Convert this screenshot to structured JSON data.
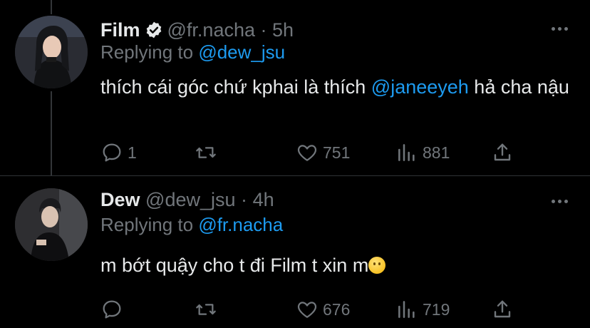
{
  "tweets": [
    {
      "name": "Film",
      "handle": "@fr.nacha",
      "separator": "·",
      "time": "5h",
      "replying_prefix": "Replying to",
      "replying_to": "@dew_jsu",
      "text_before": "thích cái góc chứ kphai là thích ",
      "text_mention": "@janeeyeh",
      "text_after": " hả cha nậu",
      "reply_count": "1",
      "retweet_count": "",
      "like_count": "751",
      "view_count": "881"
    },
    {
      "name": "Dew",
      "handle": "@dew_jsu",
      "separator": "·",
      "time": "4h",
      "replying_prefix": "Replying to",
      "replying_to": "@fr.nacha",
      "text_before": "m bớt quậy cho t đi Film t xin m",
      "reply_count": "",
      "retweet_count": "",
      "like_count": "676",
      "view_count": "719"
    }
  ],
  "icons": {
    "reply": "reply-icon",
    "retweet": "retweet-icon",
    "like": "heart-icon",
    "views": "views-icon",
    "share": "share-icon",
    "more": "more-icon",
    "verified": "verified-icon"
  },
  "colors": {
    "background": "#000000",
    "text": "#e7e9ea",
    "muted": "#71767b",
    "link": "#1d9bf0"
  }
}
